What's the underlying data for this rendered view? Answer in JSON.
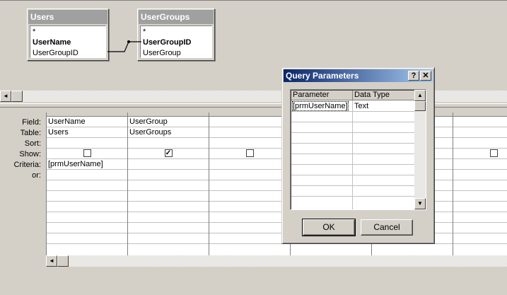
{
  "tables": [
    {
      "title": "Users",
      "fields": [
        "*",
        "UserName",
        "UserGroupID"
      ],
      "key_field": "UserName"
    },
    {
      "title": "UserGroups",
      "fields": [
        "*",
        "UserGroupID",
        "UserGroup"
      ],
      "key_field": "UserGroupID"
    }
  ],
  "grid": {
    "row_labels": [
      "Field:",
      "Table:",
      "Sort:",
      "Show:",
      "Criteria:",
      "or:"
    ],
    "columns": [
      {
        "field": "UserName",
        "table": "Users",
        "sort": "",
        "show": false,
        "criteria": "[prmUserName]"
      },
      {
        "field": "UserGroup",
        "table": "UserGroups",
        "sort": "",
        "show": true,
        "criteria": ""
      },
      {
        "field": "",
        "table": "",
        "sort": "",
        "show": false,
        "criteria": ""
      },
      {
        "field": "",
        "table": "",
        "sort": "",
        "show": false,
        "criteria": ""
      },
      {
        "field": "",
        "table": "",
        "sort": "",
        "show": false,
        "criteria": ""
      },
      {
        "field": "",
        "table": "",
        "sort": "",
        "show": false,
        "criteria": ""
      }
    ]
  },
  "dialog": {
    "title": "Query Parameters",
    "help_glyph": "?",
    "close_glyph": "✕",
    "headers": [
      "Parameter",
      "Data Type"
    ],
    "rows": [
      {
        "parameter": "[prmUserName]",
        "data_type": "Text"
      }
    ],
    "ok_label": "OK",
    "cancel_label": "Cancel"
  },
  "icons": {
    "scroll_left": "◄",
    "scroll_up": "▲",
    "scroll_down": "▼",
    "check": "✓"
  }
}
